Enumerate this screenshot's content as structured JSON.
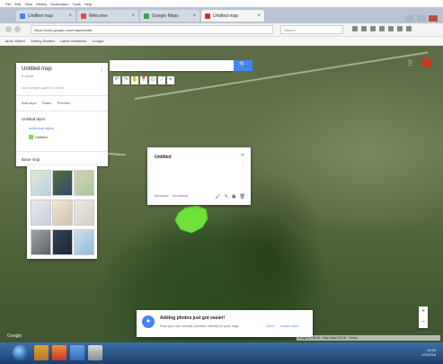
{
  "browser": {
    "menu": [
      "File",
      "Edit",
      "View",
      "History",
      "Bookmarks",
      "Tools",
      "Help"
    ],
    "tabs": [
      {
        "label": "Untitled map"
      },
      {
        "label": "Welcome"
      },
      {
        "label": "Google Maps"
      },
      {
        "label": "Untitled map"
      }
    ],
    "url": "https://www.google.com/maps/d/edit",
    "search_placeholder": "Search",
    "bookmarks": [
      "Most Visited",
      "Getting Started",
      "Latest Headlines",
      "Google"
    ]
  },
  "map": {
    "search_button": "🔍",
    "tools": [
      "↶",
      "↷",
      "✋",
      "📍",
      "◇",
      "⟋",
      "⌖"
    ],
    "zoom_in": "+",
    "zoom_out": "−",
    "logo": "Google",
    "copyright": "Imagery ©2016 · Map data ©2016 · Terms"
  },
  "panel": {
    "title": "Untitled map",
    "subtitle": "0 views",
    "note": "All changes saved in Drive",
    "actions": [
      "Add layer",
      "Share",
      "Preview"
    ],
    "layer_title": "Untitled layer",
    "layer_style": "Individual styles",
    "layer_item": "Untitled",
    "basemap_label": "Base map",
    "menu_icon": "⋮"
  },
  "card": {
    "title": "Untitled",
    "footer": [
      "Measure",
      "Directions"
    ],
    "tools": [
      "🖌",
      "✎",
      "▣",
      "🗑"
    ],
    "side_icons": [
      "✕",
      "⋮"
    ]
  },
  "toast": {
    "heading": "Adding photos just got easier!",
    "body": "Now you can upload pictures directly to your map",
    "link1": "Got it",
    "link2": "Learn more"
  },
  "taskbar": {
    "time": "12:00",
    "date": "1/1/2016"
  },
  "colors": {
    "accent": "#4285f4",
    "polygon": "#6fe23a",
    "taskbar": "#1c3f6e"
  }
}
